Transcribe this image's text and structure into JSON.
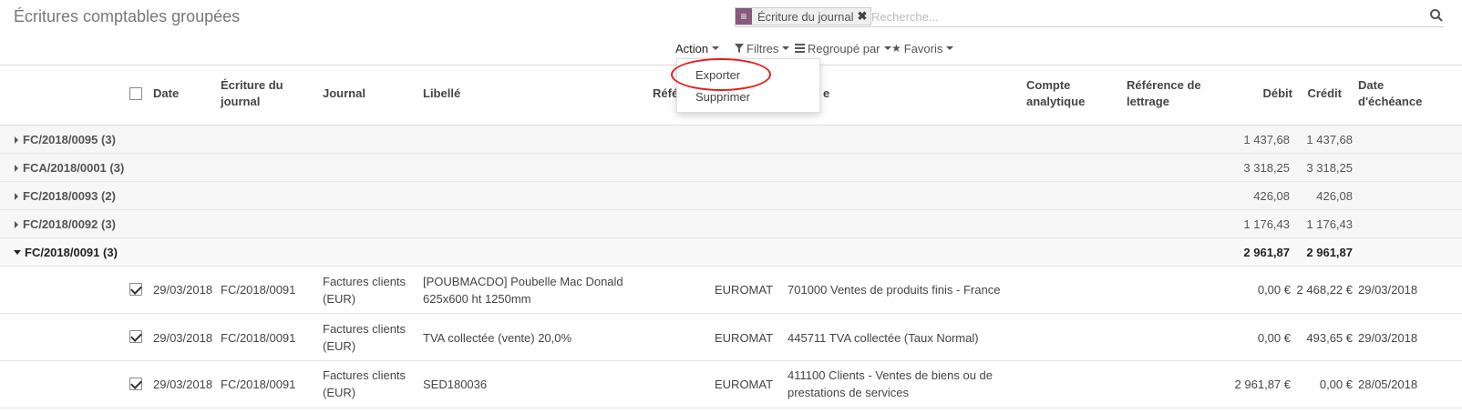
{
  "page": {
    "title": "Écritures comptables groupées"
  },
  "search": {
    "facet_label": "Écriture du journal",
    "facet_close": "✖",
    "placeholder": "Recherche..."
  },
  "controls": {
    "action": "Action",
    "filters": "Filtres",
    "group_by": "Regroupé par",
    "favorites": "Favoris"
  },
  "action_menu": {
    "items": [
      "Exporter",
      "Supprimer"
    ]
  },
  "columns": {
    "date": "Date",
    "entry_1": "Écriture du",
    "entry_2": "journal",
    "journal": "Journal",
    "label": "Libellé",
    "ref": "Réfé",
    "account": "e",
    "analytic_1": "Compte",
    "analytic_2": "analytique",
    "matching_1": "Référence de",
    "matching_2": "lettrage",
    "debit": "Débit",
    "credit": "Crédit",
    "due_1": "Date",
    "due_2": "d'échéance"
  },
  "groups": [
    {
      "label": "FC/2018/0095 (3)",
      "debit": "1 437,68",
      "credit": "1 437,68"
    },
    {
      "label": "FCA/2018/0001 (3)",
      "debit": "3 318,25",
      "credit": "3 318,25"
    },
    {
      "label": "FC/2018/0093 (2)",
      "debit": "426,08",
      "credit": "426,08"
    },
    {
      "label": "FC/2018/0092 (3)",
      "debit": "1 176,43",
      "credit": "1 176,43"
    },
    {
      "label": "FC/2018/0091 (3)",
      "debit": "2 961,87",
      "credit": "2 961,87"
    }
  ],
  "rows": [
    {
      "date": "29/03/2018",
      "entry": "FC/2018/0091",
      "journal_1": "Factures clients",
      "journal_2": "(EUR)",
      "label_1": "[POUBMACDO] Poubelle Mac Donald",
      "label_2": "625x600 ht 1250mm",
      "partner": "EUROMAT",
      "account_1": "701000 Ventes de produits finis - France",
      "account_2": "",
      "debit": "0,00 €",
      "credit": "2 468,22 €",
      "due": "29/03/2018"
    },
    {
      "date": "29/03/2018",
      "entry": "FC/2018/0091",
      "journal_1": "Factures clients",
      "journal_2": "(EUR)",
      "label_1": "TVA collectée (vente) 20,0%",
      "label_2": "",
      "partner": "EUROMAT",
      "account_1": "445711 TVA collectée (Taux Normal)",
      "account_2": "",
      "debit": "0,00 €",
      "credit": "493,65 €",
      "due": "29/03/2018"
    },
    {
      "date": "29/03/2018",
      "entry": "FC/2018/0091",
      "journal_1": "Factures clients",
      "journal_2": "(EUR)",
      "label_1": "SED180036",
      "label_2": "",
      "partner": "EUROMAT",
      "account_1": "411100 Clients - Ventes de biens ou de",
      "account_2": "prestations de services",
      "debit": "2 961,87 €",
      "credit": "0,00 €",
      "due": "28/05/2018"
    }
  ],
  "colors": {
    "accent": "#875A7B",
    "highlight_circle": "#e02020"
  }
}
